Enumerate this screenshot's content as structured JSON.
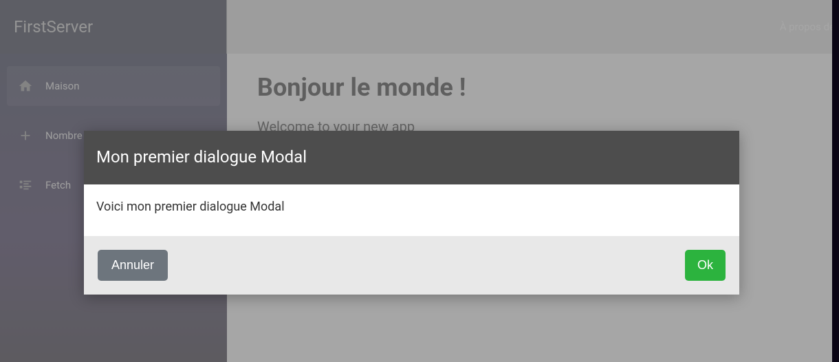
{
  "brand": "FirstServer",
  "topbar": {
    "about": "À propos de"
  },
  "sidebar": {
    "items": [
      {
        "label": "Maison"
      },
      {
        "label": "Nombre"
      },
      {
        "label": "Fetch"
      }
    ]
  },
  "main": {
    "title": "Bonjour le monde !",
    "subtitle": "Welcome to your new app"
  },
  "modal": {
    "title": "Mon premier dialogue Modal",
    "body": "Voici mon premier dialogue Modal",
    "cancel": "Annuler",
    "ok": "Ok"
  }
}
